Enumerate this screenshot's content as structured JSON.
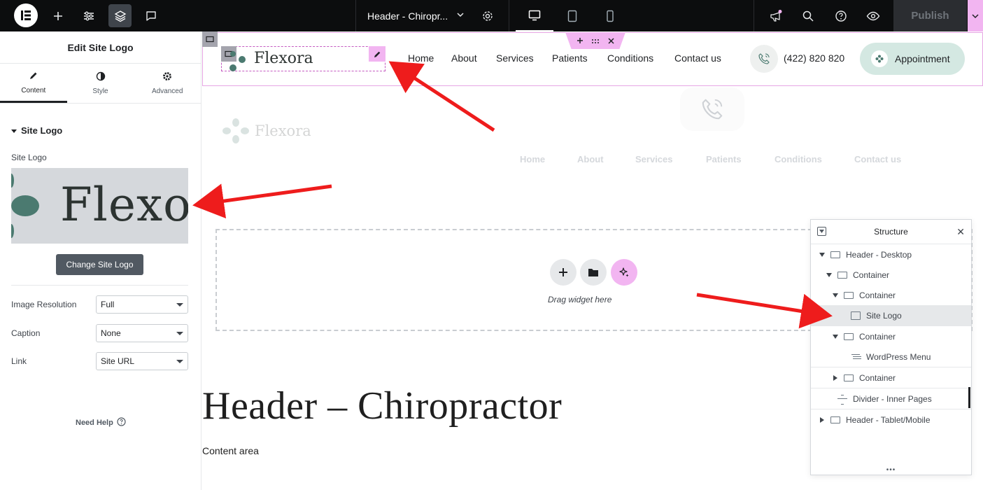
{
  "topbar": {
    "document_title": "Header - Chiropr...",
    "publish_label": "Publish",
    "accent_color": "#f2b5f1"
  },
  "panel": {
    "title": "Edit Site Logo",
    "tabs": [
      {
        "label": "Content",
        "icon": "pencil-icon"
      },
      {
        "label": "Style",
        "icon": "half-circle-icon"
      },
      {
        "label": "Advanced",
        "icon": "gear-icon"
      }
    ],
    "section_title": "Site Logo",
    "site_logo_label": "Site Logo",
    "preview_text": "Flexo",
    "change_button": "Change Site Logo",
    "fields": [
      {
        "label": "Image Resolution",
        "value": "Full"
      },
      {
        "label": "Caption",
        "value": "None"
      },
      {
        "label": "Link",
        "value": "Site URL"
      }
    ],
    "need_help": "Need Help"
  },
  "header": {
    "logo_text": "Flexora",
    "nav": [
      "Home",
      "About",
      "Services",
      "Patients",
      "Conditions",
      "Contact us"
    ],
    "phone": "(422) 820 820",
    "appointment": "Appointment",
    "brand_color": "#4b7a70"
  },
  "ghost_header": {
    "logo_text": "Flexora",
    "nav": [
      "Home",
      "About",
      "Services",
      "Patients",
      "Conditions",
      "Contact us"
    ]
  },
  "drop_zone": {
    "text": "Drag widget here"
  },
  "page": {
    "heading": "Header – Chiropractor",
    "content": "Content area"
  },
  "structure": {
    "title": "Structure",
    "items": [
      {
        "label": "Header - Desktop"
      },
      {
        "label": "Container"
      },
      {
        "label": "Container"
      },
      {
        "label": "Site Logo"
      },
      {
        "label": "Container"
      },
      {
        "label": "WordPress Menu"
      },
      {
        "label": "Container"
      },
      {
        "label": "Divider - Inner Pages"
      },
      {
        "label": "Header - Tablet/Mobile"
      }
    ]
  }
}
